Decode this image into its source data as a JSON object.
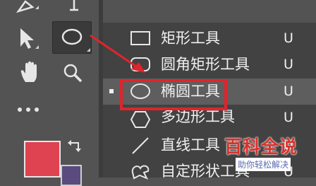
{
  "menu": {
    "items": [
      {
        "label": "矩形工具",
        "shortcut": "U",
        "icon": "rectangle-icon",
        "selected": false
      },
      {
        "label": "圆角矩形工具",
        "shortcut": "U",
        "icon": "rounded-rectangle-icon",
        "selected": false
      },
      {
        "label": "椭圆工具",
        "shortcut": "U",
        "icon": "ellipse-icon",
        "selected": true
      },
      {
        "label": "多边形工具",
        "shortcut": "U",
        "icon": "polygon-icon",
        "selected": false
      },
      {
        "label": "直线工具",
        "shortcut": "U",
        "icon": "line-icon",
        "selected": false
      },
      {
        "label": "自定形状工具",
        "shortcut": "U",
        "icon": "custom-shape-icon",
        "selected": false
      }
    ]
  },
  "toolbar": {
    "tools": [
      "pen-icon",
      "type-icon",
      "move-arrow-icon",
      "ellipse-tool-icon",
      "hand-icon",
      "zoom-icon",
      "more-tools-icon",
      "swap-colors-icon"
    ]
  },
  "colors": {
    "foreground": "#df4250",
    "background": "#5a4a7e",
    "annotation": "#e0242c"
  },
  "watermark": {
    "title": "百科全说",
    "subtitle": "助你轻松解决"
  }
}
